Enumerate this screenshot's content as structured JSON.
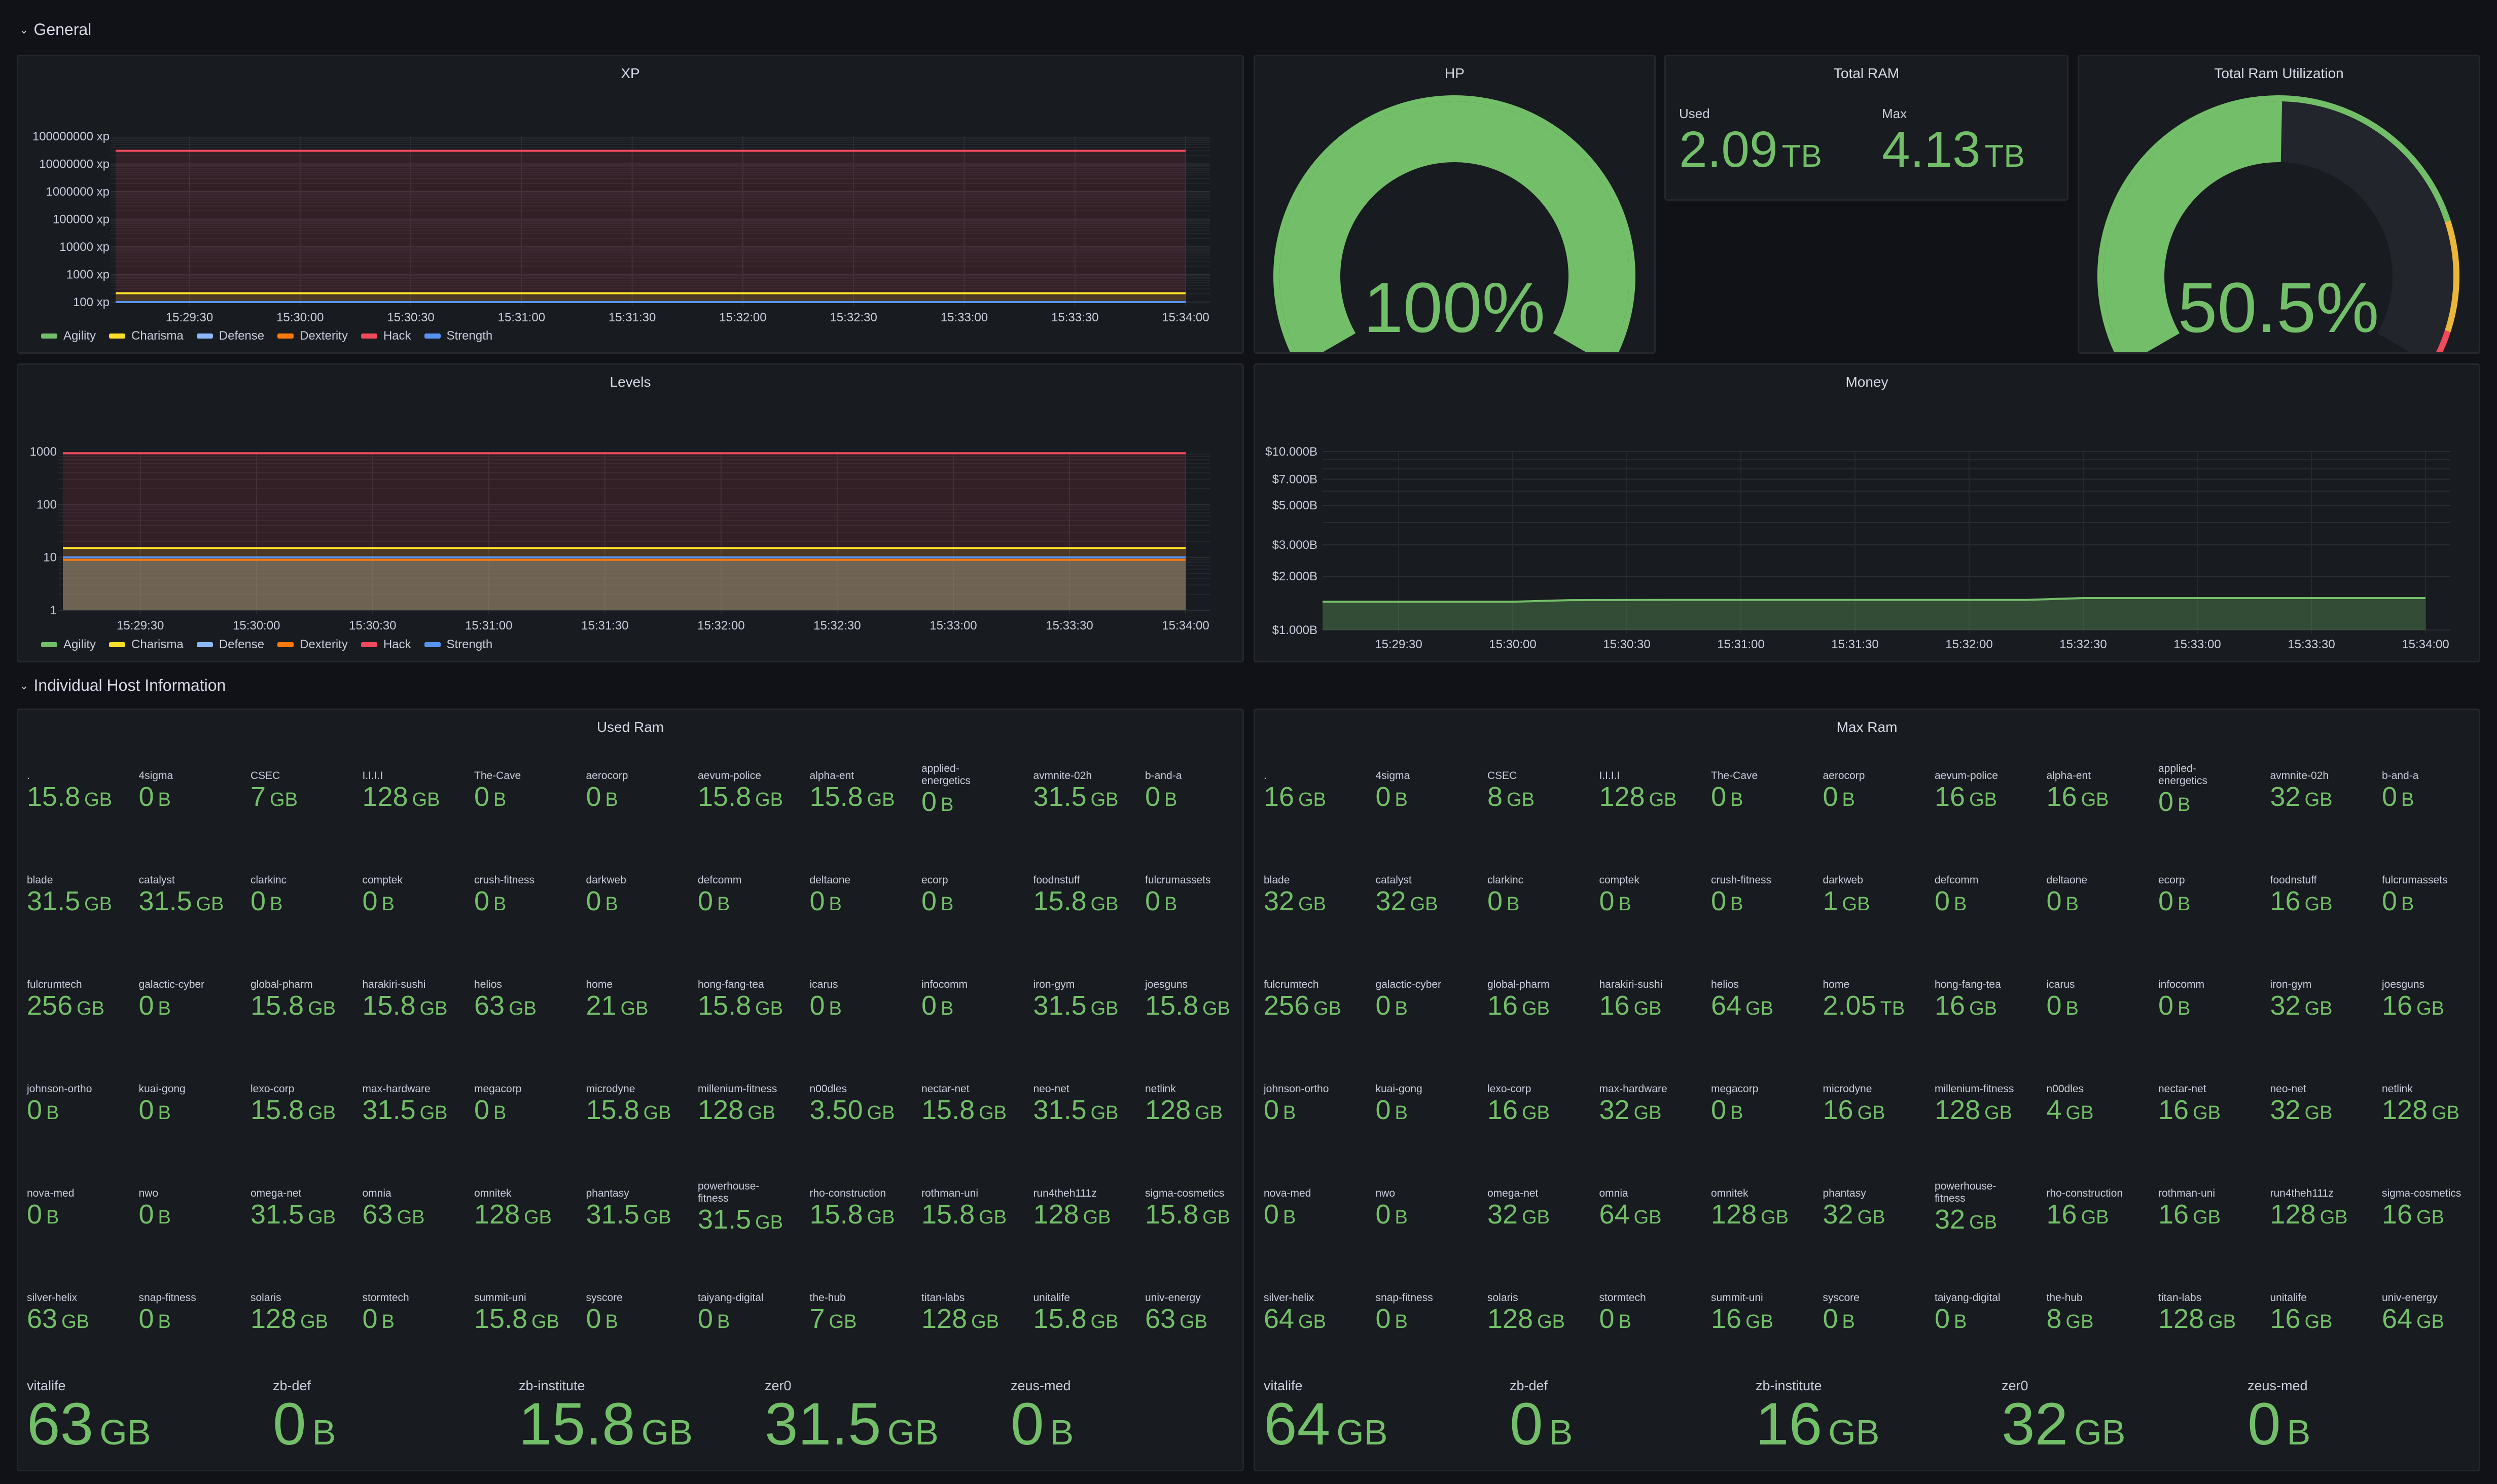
{
  "rows": [
    {
      "title": "General",
      "expanded": true
    },
    {
      "title": "Individual Host Information",
      "expanded": true
    }
  ],
  "colors": {
    "green": "#73bf69",
    "yellow": "#fade2a",
    "light_blue": "#8ab8ff",
    "orange": "#ff780a",
    "red": "#f2495c",
    "blue": "#5794f2",
    "amber": "#eab839",
    "bg": "#111217",
    "panel_bg": "#181b1f"
  },
  "xp_panel": {
    "title": "XP",
    "chart_data": {
      "type": "area",
      "title": "XP",
      "yscale": "log",
      "ylim": [
        100,
        100000000
      ],
      "yticks": [
        "100 xp",
        "1000 xp",
        "10000 xp",
        "100000 xp",
        "1000000 xp",
        "10000000 xp",
        "100000000 xp"
      ],
      "ytick_values": [
        100,
        1000,
        10000,
        100000,
        1000000,
        10000000,
        100000000
      ],
      "x": [
        "15:29:10",
        "15:34:00"
      ],
      "xticks": [
        "15:29:30",
        "15:30:00",
        "15:30:30",
        "15:31:00",
        "15:31:30",
        "15:32:00",
        "15:32:30",
        "15:33:00",
        "15:33:30",
        "15:34:00"
      ],
      "legend_placement": "bottom-left",
      "series": [
        {
          "name": "Agility",
          "color": "#73bf69",
          "values": [
            100,
            100
          ]
        },
        {
          "name": "Charisma",
          "color": "#fade2a",
          "values": [
            210,
            210
          ]
        },
        {
          "name": "Defense",
          "color": "#8ab8ff",
          "values": [
            100,
            100
          ]
        },
        {
          "name": "Dexterity",
          "color": "#ff780a",
          "values": [
            100,
            100
          ]
        },
        {
          "name": "Hack",
          "color": "#f2495c",
          "values": [
            30000000,
            30000000
          ]
        },
        {
          "name": "Strength",
          "color": "#5794f2",
          "values": [
            100,
            100
          ]
        }
      ]
    }
  },
  "levels_panel": {
    "title": "Levels",
    "chart_data": {
      "type": "area",
      "title": "Levels",
      "yscale": "log",
      "ylim": [
        1,
        1000
      ],
      "yticks": [
        "1",
        "10",
        "100",
        "1000"
      ],
      "ytick_values": [
        1,
        10,
        100,
        1000
      ],
      "x": [
        "15:29:10",
        "15:34:00"
      ],
      "xticks": [
        "15:29:30",
        "15:30:00",
        "15:30:30",
        "15:31:00",
        "15:31:30",
        "15:32:00",
        "15:32:30",
        "15:33:00",
        "15:33:30",
        "15:34:00"
      ],
      "legend_placement": "bottom-left",
      "series": [
        {
          "name": "Agility",
          "color": "#73bf69",
          "values": [
            9,
            9
          ]
        },
        {
          "name": "Charisma",
          "color": "#fade2a",
          "values": [
            15,
            15
          ]
        },
        {
          "name": "Defense",
          "color": "#8ab8ff",
          "values": [
            9,
            9
          ]
        },
        {
          "name": "Dexterity",
          "color": "#ff780a",
          "values": [
            9,
            9
          ]
        },
        {
          "name": "Hack",
          "color": "#f2495c",
          "values": [
            930,
            930
          ]
        },
        {
          "name": "Strength",
          "color": "#5794f2",
          "values": [
            10,
            10
          ]
        }
      ]
    }
  },
  "money_panel": {
    "title": "Money",
    "chart_data": {
      "type": "area",
      "title": "Money",
      "yscale": "log",
      "ylim": [
        1.0,
        10.0
      ],
      "yunit": "B",
      "yticks": [
        "$1.000B",
        "$2.000B",
        "$3.000B",
        "$5.000B",
        "$7.000B",
        "$10.000B"
      ],
      "ytick_values": [
        1,
        2,
        3,
        5,
        7,
        10
      ],
      "xticks": [
        "15:29:30",
        "15:30:00",
        "15:30:30",
        "15:31:00",
        "15:31:30",
        "15:32:00",
        "15:32:30",
        "15:33:00",
        "15:33:30",
        "15:34:00"
      ],
      "series": [
        {
          "name": "Money",
          "color": "#73bf69",
          "x": [
            "15:29:10",
            "15:30:00",
            "15:30:15",
            "15:30:45",
            "15:32:15",
            "15:32:30",
            "15:34:00"
          ],
          "values": [
            1.44,
            1.44,
            1.47,
            1.475,
            1.475,
            1.51,
            1.51
          ]
        }
      ]
    }
  },
  "hp_panel": {
    "title": "HP",
    "value": "100%",
    "fraction": 1.0
  },
  "total_ram_panel": {
    "title": "Total RAM",
    "stats": [
      {
        "label": "Used",
        "value": "2.09",
        "unit": "TB"
      },
      {
        "label": "Max",
        "value": "4.13",
        "unit": "TB"
      }
    ]
  },
  "ram_util_panel": {
    "title": "Total Ram Utilization",
    "value": "50.5%",
    "fraction": 0.505,
    "thresholds": [
      {
        "from": 0,
        "to": 0.8,
        "color": "#73bf69"
      },
      {
        "from": 0.8,
        "to": 0.95,
        "color": "#eab839"
      },
      {
        "from": 0.95,
        "to": 1.0,
        "color": "#f2495c"
      }
    ]
  },
  "used_ram_panel": {
    "title": "Used Ram",
    "hosts": [
      {
        "name": ".",
        "value": "15.8",
        "unit": "GB"
      },
      {
        "name": "4sigma",
        "value": "0",
        "unit": "B"
      },
      {
        "name": "CSEC",
        "value": "7",
        "unit": "GB"
      },
      {
        "name": "I.I.I.I",
        "value": "128",
        "unit": "GB"
      },
      {
        "name": "The-Cave",
        "value": "0",
        "unit": "B"
      },
      {
        "name": "aerocorp",
        "value": "0",
        "unit": "B"
      },
      {
        "name": "aevum-police",
        "value": "15.8",
        "unit": "GB"
      },
      {
        "name": "alpha-ent",
        "value": "15.8",
        "unit": "GB"
      },
      {
        "name": "applied-energetics",
        "value": "0",
        "unit": "B"
      },
      {
        "name": "avmnite-02h",
        "value": "31.5",
        "unit": "GB"
      },
      {
        "name": "b-and-a",
        "value": "0",
        "unit": "B"
      },
      {
        "name": "blade",
        "value": "31.5",
        "unit": "GB"
      },
      {
        "name": "catalyst",
        "value": "31.5",
        "unit": "GB"
      },
      {
        "name": "clarkinc",
        "value": "0",
        "unit": "B"
      },
      {
        "name": "comptek",
        "value": "0",
        "unit": "B"
      },
      {
        "name": "crush-fitness",
        "value": "0",
        "unit": "B"
      },
      {
        "name": "darkweb",
        "value": "0",
        "unit": "B"
      },
      {
        "name": "defcomm",
        "value": "0",
        "unit": "B"
      },
      {
        "name": "deltaone",
        "value": "0",
        "unit": "B"
      },
      {
        "name": "ecorp",
        "value": "0",
        "unit": "B"
      },
      {
        "name": "foodnstuff",
        "value": "15.8",
        "unit": "GB"
      },
      {
        "name": "fulcrumassets",
        "value": "0",
        "unit": "B"
      },
      {
        "name": "fulcrumtech",
        "value": "256",
        "unit": "GB"
      },
      {
        "name": "galactic-cyber",
        "value": "0",
        "unit": "B"
      },
      {
        "name": "global-pharm",
        "value": "15.8",
        "unit": "GB"
      },
      {
        "name": "harakiri-sushi",
        "value": "15.8",
        "unit": "GB"
      },
      {
        "name": "helios",
        "value": "63",
        "unit": "GB"
      },
      {
        "name": "home",
        "value": "21",
        "unit": "GB"
      },
      {
        "name": "hong-fang-tea",
        "value": "15.8",
        "unit": "GB"
      },
      {
        "name": "icarus",
        "value": "0",
        "unit": "B"
      },
      {
        "name": "infocomm",
        "value": "0",
        "unit": "B"
      },
      {
        "name": "iron-gym",
        "value": "31.5",
        "unit": "GB"
      },
      {
        "name": "joesguns",
        "value": "15.8",
        "unit": "GB"
      },
      {
        "name": "johnson-ortho",
        "value": "0",
        "unit": "B"
      },
      {
        "name": "kuai-gong",
        "value": "0",
        "unit": "B"
      },
      {
        "name": "lexo-corp",
        "value": "15.8",
        "unit": "GB"
      },
      {
        "name": "max-hardware",
        "value": "31.5",
        "unit": "GB"
      },
      {
        "name": "megacorp",
        "value": "0",
        "unit": "B"
      },
      {
        "name": "microdyne",
        "value": "15.8",
        "unit": "GB"
      },
      {
        "name": "millenium-fitness",
        "value": "128",
        "unit": "GB"
      },
      {
        "name": "n00dles",
        "value": "3.50",
        "unit": "GB"
      },
      {
        "name": "nectar-net",
        "value": "15.8",
        "unit": "GB"
      },
      {
        "name": "neo-net",
        "value": "31.5",
        "unit": "GB"
      },
      {
        "name": "netlink",
        "value": "128",
        "unit": "GB"
      },
      {
        "name": "nova-med",
        "value": "0",
        "unit": "B"
      },
      {
        "name": "nwo",
        "value": "0",
        "unit": "B"
      },
      {
        "name": "omega-net",
        "value": "31.5",
        "unit": "GB"
      },
      {
        "name": "omnia",
        "value": "63",
        "unit": "GB"
      },
      {
        "name": "omnitek",
        "value": "128",
        "unit": "GB"
      },
      {
        "name": "phantasy",
        "value": "31.5",
        "unit": "GB"
      },
      {
        "name": "powerhouse-fitness",
        "value": "31.5",
        "unit": "GB"
      },
      {
        "name": "rho-construction",
        "value": "15.8",
        "unit": "GB"
      },
      {
        "name": "rothman-uni",
        "value": "15.8",
        "unit": "GB"
      },
      {
        "name": "run4theh111z",
        "value": "128",
        "unit": "GB"
      },
      {
        "name": "sigma-cosmetics",
        "value": "15.8",
        "unit": "GB"
      },
      {
        "name": "silver-helix",
        "value": "63",
        "unit": "GB"
      },
      {
        "name": "snap-fitness",
        "value": "0",
        "unit": "B"
      },
      {
        "name": "solaris",
        "value": "128",
        "unit": "GB"
      },
      {
        "name": "stormtech",
        "value": "0",
        "unit": "B"
      },
      {
        "name": "summit-uni",
        "value": "15.8",
        "unit": "GB"
      },
      {
        "name": "syscore",
        "value": "0",
        "unit": "B"
      },
      {
        "name": "taiyang-digital",
        "value": "0",
        "unit": "B"
      },
      {
        "name": "the-hub",
        "value": "7",
        "unit": "GB"
      },
      {
        "name": "titan-labs",
        "value": "128",
        "unit": "GB"
      },
      {
        "name": "unitalife",
        "value": "15.8",
        "unit": "GB"
      },
      {
        "name": "univ-energy",
        "value": "63",
        "unit": "GB"
      }
    ],
    "big_hosts": [
      {
        "name": "vitalife",
        "value": "63",
        "unit": "GB"
      },
      {
        "name": "zb-def",
        "value": "0",
        "unit": "B"
      },
      {
        "name": "zb-institute",
        "value": "15.8",
        "unit": "GB"
      },
      {
        "name": "zer0",
        "value": "31.5",
        "unit": "GB"
      },
      {
        "name": "zeus-med",
        "value": "0",
        "unit": "B"
      }
    ]
  },
  "max_ram_panel": {
    "title": "Max Ram",
    "hosts": [
      {
        "name": ".",
        "value": "16",
        "unit": "GB"
      },
      {
        "name": "4sigma",
        "value": "0",
        "unit": "B"
      },
      {
        "name": "CSEC",
        "value": "8",
        "unit": "GB"
      },
      {
        "name": "I.I.I.I",
        "value": "128",
        "unit": "GB"
      },
      {
        "name": "The-Cave",
        "value": "0",
        "unit": "B"
      },
      {
        "name": "aerocorp",
        "value": "0",
        "unit": "B"
      },
      {
        "name": "aevum-police",
        "value": "16",
        "unit": "GB"
      },
      {
        "name": "alpha-ent",
        "value": "16",
        "unit": "GB"
      },
      {
        "name": "applied-energetics",
        "value": "0",
        "unit": "B"
      },
      {
        "name": "avmnite-02h",
        "value": "32",
        "unit": "GB"
      },
      {
        "name": "b-and-a",
        "value": "0",
        "unit": "B"
      },
      {
        "name": "blade",
        "value": "32",
        "unit": "GB"
      },
      {
        "name": "catalyst",
        "value": "32",
        "unit": "GB"
      },
      {
        "name": "clarkinc",
        "value": "0",
        "unit": "B"
      },
      {
        "name": "comptek",
        "value": "0",
        "unit": "B"
      },
      {
        "name": "crush-fitness",
        "value": "0",
        "unit": "B"
      },
      {
        "name": "darkweb",
        "value": "1",
        "unit": "GB"
      },
      {
        "name": "defcomm",
        "value": "0",
        "unit": "B"
      },
      {
        "name": "deltaone",
        "value": "0",
        "unit": "B"
      },
      {
        "name": "ecorp",
        "value": "0",
        "unit": "B"
      },
      {
        "name": "foodnstuff",
        "value": "16",
        "unit": "GB"
      },
      {
        "name": "fulcrumassets",
        "value": "0",
        "unit": "B"
      },
      {
        "name": "fulcrumtech",
        "value": "256",
        "unit": "GB"
      },
      {
        "name": "galactic-cyber",
        "value": "0",
        "unit": "B"
      },
      {
        "name": "global-pharm",
        "value": "16",
        "unit": "GB"
      },
      {
        "name": "harakiri-sushi",
        "value": "16",
        "unit": "GB"
      },
      {
        "name": "helios",
        "value": "64",
        "unit": "GB"
      },
      {
        "name": "home",
        "value": "2.05",
        "unit": "TB"
      },
      {
        "name": "hong-fang-tea",
        "value": "16",
        "unit": "GB"
      },
      {
        "name": "icarus",
        "value": "0",
        "unit": "B"
      },
      {
        "name": "infocomm",
        "value": "0",
        "unit": "B"
      },
      {
        "name": "iron-gym",
        "value": "32",
        "unit": "GB"
      },
      {
        "name": "joesguns",
        "value": "16",
        "unit": "GB"
      },
      {
        "name": "johnson-ortho",
        "value": "0",
        "unit": "B"
      },
      {
        "name": "kuai-gong",
        "value": "0",
        "unit": "B"
      },
      {
        "name": "lexo-corp",
        "value": "16",
        "unit": "GB"
      },
      {
        "name": "max-hardware",
        "value": "32",
        "unit": "GB"
      },
      {
        "name": "megacorp",
        "value": "0",
        "unit": "B"
      },
      {
        "name": "microdyne",
        "value": "16",
        "unit": "GB"
      },
      {
        "name": "millenium-fitness",
        "value": "128",
        "unit": "GB"
      },
      {
        "name": "n00dles",
        "value": "4",
        "unit": "GB"
      },
      {
        "name": "nectar-net",
        "value": "16",
        "unit": "GB"
      },
      {
        "name": "neo-net",
        "value": "32",
        "unit": "GB"
      },
      {
        "name": "netlink",
        "value": "128",
        "unit": "GB"
      },
      {
        "name": "nova-med",
        "value": "0",
        "unit": "B"
      },
      {
        "name": "nwo",
        "value": "0",
        "unit": "B"
      },
      {
        "name": "omega-net",
        "value": "32",
        "unit": "GB"
      },
      {
        "name": "omnia",
        "value": "64",
        "unit": "GB"
      },
      {
        "name": "omnitek",
        "value": "128",
        "unit": "GB"
      },
      {
        "name": "phantasy",
        "value": "32",
        "unit": "GB"
      },
      {
        "name": "powerhouse-fitness",
        "value": "32",
        "unit": "GB"
      },
      {
        "name": "rho-construction",
        "value": "16",
        "unit": "GB"
      },
      {
        "name": "rothman-uni",
        "value": "16",
        "unit": "GB"
      },
      {
        "name": "run4theh111z",
        "value": "128",
        "unit": "GB"
      },
      {
        "name": "sigma-cosmetics",
        "value": "16",
        "unit": "GB"
      },
      {
        "name": "silver-helix",
        "value": "64",
        "unit": "GB"
      },
      {
        "name": "snap-fitness",
        "value": "0",
        "unit": "B"
      },
      {
        "name": "solaris",
        "value": "128",
        "unit": "GB"
      },
      {
        "name": "stormtech",
        "value": "0",
        "unit": "B"
      },
      {
        "name": "summit-uni",
        "value": "16",
        "unit": "GB"
      },
      {
        "name": "syscore",
        "value": "0",
        "unit": "B"
      },
      {
        "name": "taiyang-digital",
        "value": "0",
        "unit": "B"
      },
      {
        "name": "the-hub",
        "value": "8",
        "unit": "GB"
      },
      {
        "name": "titan-labs",
        "value": "128",
        "unit": "GB"
      },
      {
        "name": "unitalife",
        "value": "16",
        "unit": "GB"
      },
      {
        "name": "univ-energy",
        "value": "64",
        "unit": "GB"
      }
    ],
    "big_hosts": [
      {
        "name": "vitalife",
        "value": "64",
        "unit": "GB"
      },
      {
        "name": "zb-def",
        "value": "0",
        "unit": "B"
      },
      {
        "name": "zb-institute",
        "value": "16",
        "unit": "GB"
      },
      {
        "name": "zer0",
        "value": "32",
        "unit": "GB"
      },
      {
        "name": "zeus-med",
        "value": "0",
        "unit": "B"
      }
    ]
  }
}
